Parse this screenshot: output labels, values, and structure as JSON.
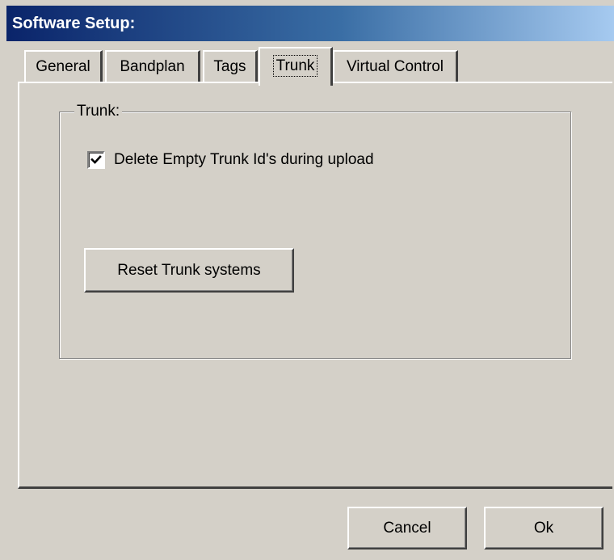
{
  "window": {
    "title": "Software Setup:"
  },
  "tabs": [
    {
      "label": "General",
      "active": false
    },
    {
      "label": "Bandplan",
      "active": false
    },
    {
      "label": "Tags",
      "active": false
    },
    {
      "label": "Trunk",
      "active": true
    },
    {
      "label": "Virtual Control",
      "active": false
    }
  ],
  "trunk_panel": {
    "group_label": "Trunk:",
    "delete_empty_checkbox": {
      "label": "Delete Empty Trunk Id's during upload",
      "checked": true
    },
    "reset_button_label": "Reset Trunk systems"
  },
  "footer": {
    "cancel_label": "Cancel",
    "ok_label": "Ok"
  },
  "icons": {
    "checkmark": "check-icon"
  }
}
